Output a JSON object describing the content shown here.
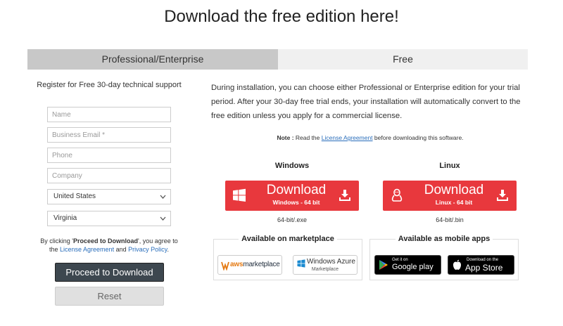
{
  "page": {
    "title": "Download the free edition here!"
  },
  "tabs": [
    {
      "label": "Professional/Enterprise"
    },
    {
      "label": "Free"
    }
  ],
  "form": {
    "support_text": "Register for Free 30-day technical support",
    "name_placeholder": "Name",
    "email_placeholder": "Business Email *",
    "phone_placeholder": "Phone",
    "company_placeholder": "Company",
    "country_value": "United States",
    "state_value": "Virginia",
    "consent_prefix": "By clicking '",
    "consent_bold": "Proceed to Download",
    "consent_mid": "', you agree to",
    "consent_the": "the ",
    "license_link": "License Agreement",
    "consent_and": " and ",
    "privacy_link": "Privacy Policy",
    "consent_end": ".",
    "proceed_label": "Proceed to Download",
    "reset_label": "Reset"
  },
  "info": {
    "intro": "During installation, you can choose either Professional or Enterprise edition for your trial period. After your 30-day free trial ends, your installation will automatically convert to the free edition unless you apply for a commercial license.",
    "note_label": "Note :",
    "note_pre": " Read the ",
    "note_link": "License Agreement",
    "note_post": " before downloading this software."
  },
  "downloads": {
    "windows": {
      "os": "Windows",
      "label": "Download",
      "sub": "Windows - 64 bit",
      "ext": "64-bit/.exe"
    },
    "linux": {
      "os": "Linux",
      "label": "Download",
      "sub": "Linux - 64 bit",
      "ext": "64-bit/.bin"
    }
  },
  "marketplace": {
    "title": "Available on marketplace",
    "aws": {
      "a": "aws",
      "b": "marketplace"
    },
    "azure": {
      "line1": "Windows Azure",
      "line2": "Marketplace"
    }
  },
  "mobile": {
    "title": "Available as mobile apps",
    "google": {
      "small": "Get it on",
      "big": "Google play"
    },
    "apple": {
      "small": "Download on the",
      "big": "App Store"
    }
  },
  "colors": {
    "download_red": "#e8383d",
    "proceed_dark": "#3d474f",
    "link_blue": "#2a6ebb",
    "tab_active": "#c8c8c8",
    "tab_inactive": "#f0f0f0"
  }
}
